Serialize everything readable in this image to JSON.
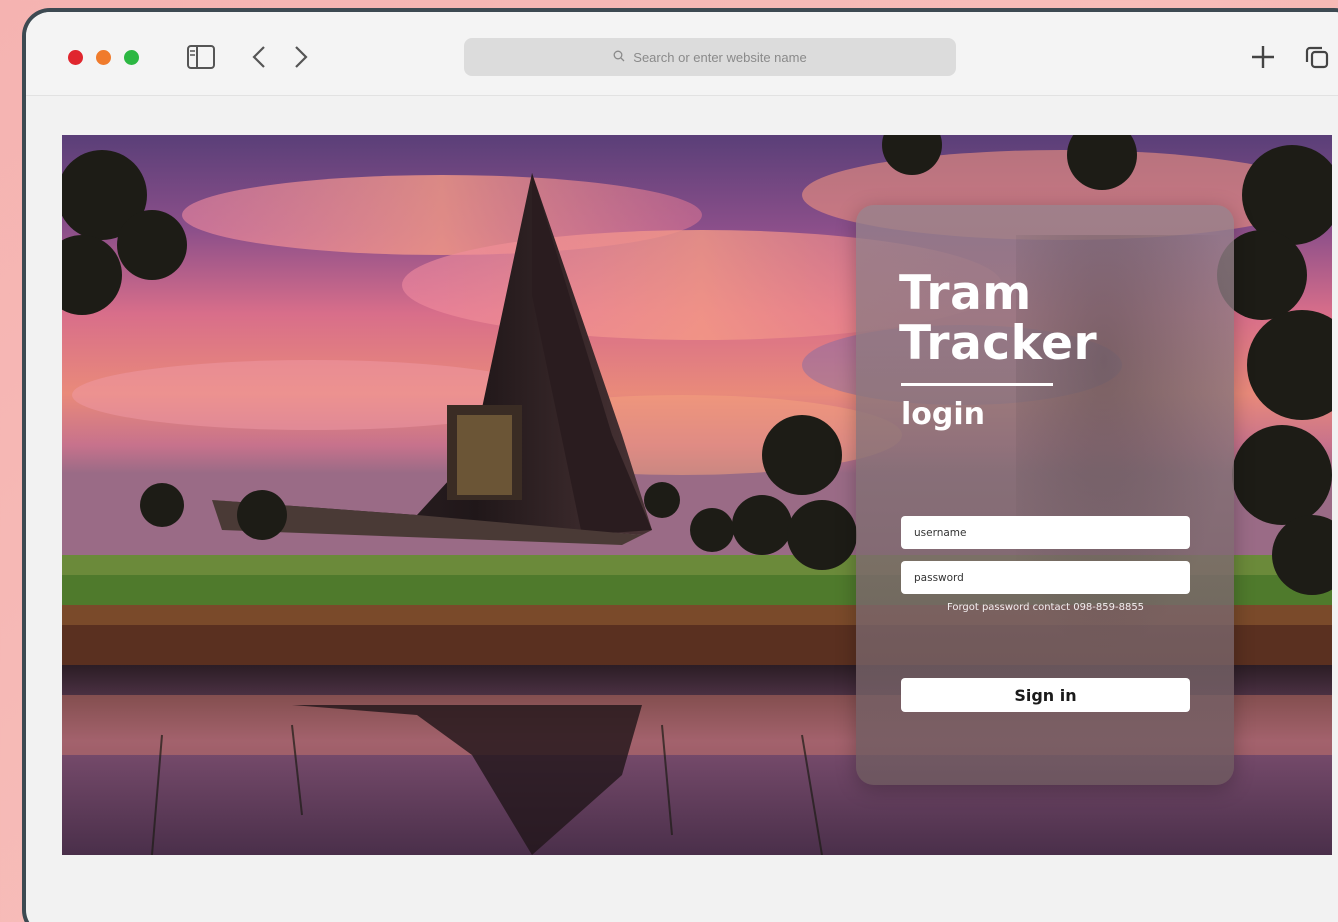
{
  "browser": {
    "address_placeholder": "Search or enter website name"
  },
  "login": {
    "title_line1": "Tram",
    "title_line2": "Tracker",
    "subtitle": "login",
    "username_placeholder": "username",
    "password_placeholder": "password",
    "forgot_text": "Forgot password contact 098-859-8855",
    "signin_label": "Sign in"
  },
  "colors": {
    "page_background": "#f5b3b1",
    "window_frame": "#3d4a52",
    "traffic_red": "#e0262e",
    "traffic_orange": "#f07b2c",
    "traffic_green": "#2cb742"
  },
  "icons": [
    "sidebar-icon",
    "chevron-left-icon",
    "chevron-right-icon",
    "search-icon",
    "plus-icon",
    "tabs-icon"
  ]
}
